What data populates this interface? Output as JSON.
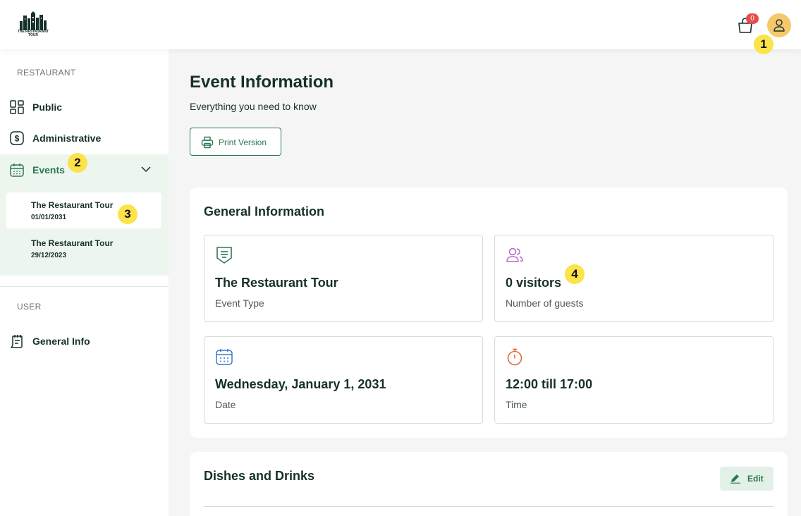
{
  "header": {
    "logo_text": "THE RESTAURANT TOUR",
    "cart_count": "0",
    "icons": [
      "logo-icon",
      "shopping-bag-icon",
      "user-icon"
    ]
  },
  "markers": [
    "1",
    "2",
    "3",
    "4"
  ],
  "sidebar": {
    "restaurant_label": "RESTAURANT",
    "items": [
      {
        "label": "Public",
        "icon": "grid-icon"
      },
      {
        "label": "Administrative",
        "icon": "dollar-icon"
      },
      {
        "label": "Events",
        "icon": "calendar-icon",
        "expanded": true
      }
    ],
    "events": [
      {
        "title": "The Restaurant Tour",
        "date": "01/01/2031",
        "active": true
      },
      {
        "title": "The Restaurant Tour",
        "date": "29/12/2023",
        "active": false
      }
    ],
    "user_label": "USER",
    "user_items": [
      {
        "label": "General Info",
        "icon": "notepad-icon"
      }
    ]
  },
  "main": {
    "title": "Event Information",
    "subtitle": "Everything you need to know",
    "print_label": "Print Version",
    "general": {
      "title": "General Information",
      "tiles": [
        {
          "value": "The Restaurant Tour",
          "caption": "Event Type",
          "icon": "menu-shield-icon",
          "color": "#2a7a4f"
        },
        {
          "value": "0 visitors",
          "caption": "Number of guests",
          "icon": "guests-icon",
          "color": "#b865c9"
        },
        {
          "value": "Wednesday, January 1, 2031",
          "caption": "Date",
          "icon": "calendar-icon",
          "color": "#3b79c9"
        },
        {
          "value": "12:00 till 17:00",
          "caption": "Time",
          "icon": "stopwatch-icon",
          "color": "#e06a3c"
        }
      ]
    },
    "dishes": {
      "title": "Dishes and Drinks",
      "edit_label": "Edit"
    }
  },
  "colors": {
    "brand_green": "#2a7a4f",
    "text_dark": "#16302b",
    "badge_red": "#e74c4c",
    "avatar_yellow": "#f6c86b",
    "events_bg": "#edf5ef"
  }
}
